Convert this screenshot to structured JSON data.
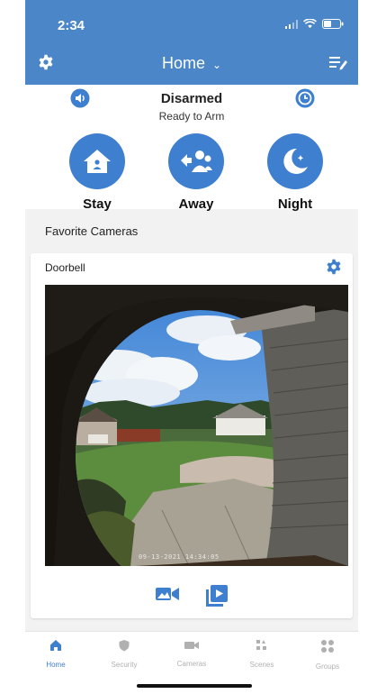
{
  "status_bar": {
    "time": "2:34"
  },
  "header": {
    "title": "Home",
    "chevron": "⌄"
  },
  "security": {
    "status": "Disarmed",
    "substatus": "Ready to Arm",
    "modes": [
      {
        "label": "Stay",
        "icon": "home-icon"
      },
      {
        "label": "Away",
        "icon": "people-icon"
      },
      {
        "label": "Night",
        "icon": "moon-icon"
      }
    ]
  },
  "favorites": {
    "title": "Favorite Cameras",
    "camera": {
      "name": "Doorbell",
      "timestamp": "09-13-2021 14:34:05"
    }
  },
  "tabs": [
    {
      "label": "Home",
      "icon": "home-icon",
      "active": true
    },
    {
      "label": "Security",
      "icon": "shield-icon",
      "active": false
    },
    {
      "label": "Cameras",
      "icon": "camera-icon",
      "active": false
    },
    {
      "label": "Scenes",
      "icon": "scenes-icon",
      "active": false
    },
    {
      "label": "Groups",
      "icon": "groups-icon",
      "active": false
    }
  ],
  "colors": {
    "primary": "#4a86c8",
    "accent": "#3f7fd0",
    "inactive": "#b0b0b0"
  }
}
